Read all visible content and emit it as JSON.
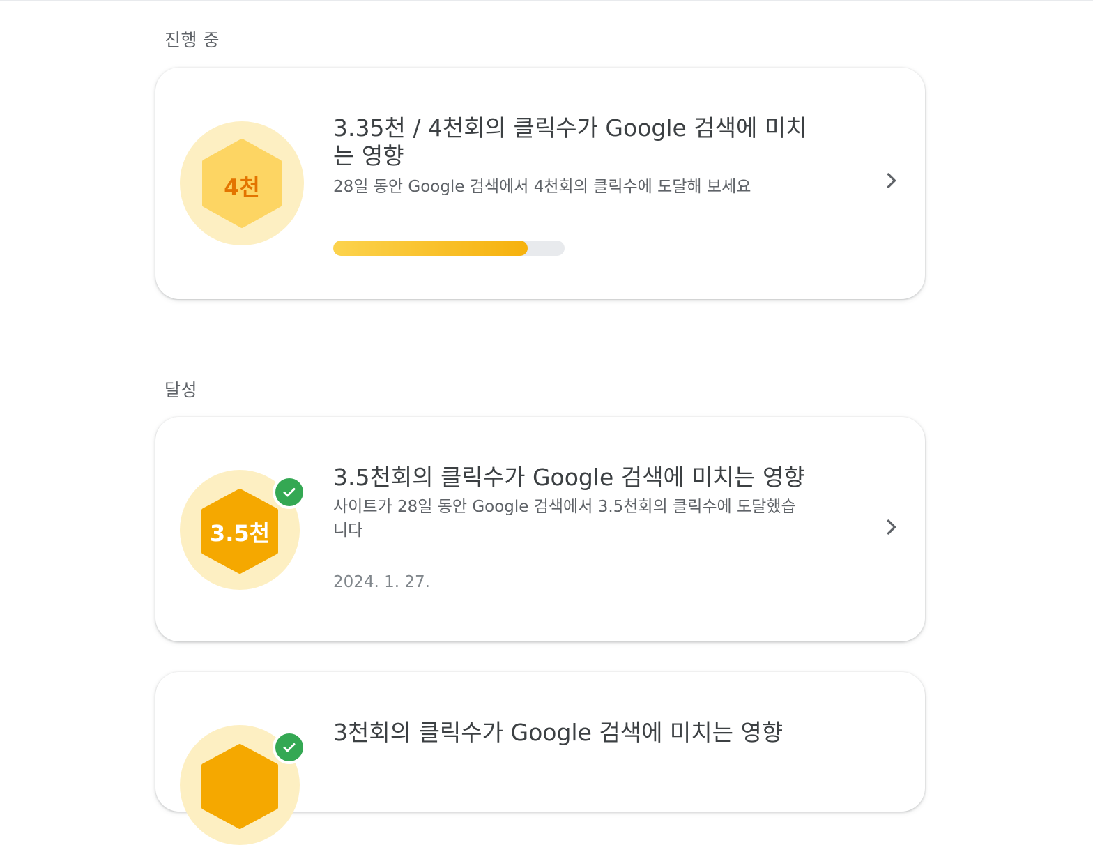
{
  "sections": {
    "in_progress_label": "진행 중",
    "achieved_label": "달성"
  },
  "in_progress": {
    "badge_label": "4천",
    "title_line1": "3.35천 / 4천회의 클릭수가 Google 검색에 미치",
    "title_line2": "는 영향",
    "description": "28일 동안 Google 검색에서 4천회의 클릭수에 도달해 보세요",
    "progress": 0.84
  },
  "achieved": [
    {
      "badge_label": "3.5천",
      "title": "3.5천회의 클릭수가 Google 검색에 미치는 영향",
      "description_line1": "사이트가 28일 동안 Google 검색에서 3.5천회의 클릭수에 도달했습",
      "description_line2": "니다",
      "date": "2024. 1. 27."
    },
    {
      "title": "3천회의 클릭수가 Google 검색에 미치는 영향"
    }
  ],
  "colors": {
    "hex_light": "#fdd563",
    "hex_dark": "#f5a800",
    "badge_bg": "#fdefc2",
    "check": "#34a853"
  }
}
